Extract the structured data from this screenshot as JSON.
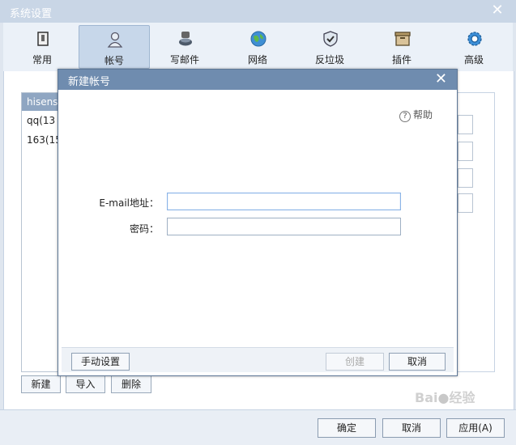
{
  "window": {
    "title": "系统设置"
  },
  "toolbar": {
    "items": [
      {
        "label": "常用",
        "icon": "general-icon"
      },
      {
        "label": "帐号",
        "icon": "account-icon"
      },
      {
        "label": "写邮件",
        "icon": "compose-icon"
      },
      {
        "label": "网络",
        "icon": "network-icon"
      },
      {
        "label": "反垃圾",
        "icon": "antispam-icon"
      },
      {
        "label": "插件",
        "icon": "plugin-icon"
      },
      {
        "label": "高级",
        "icon": "advanced-gear-icon"
      }
    ]
  },
  "accounts": {
    "header": "hisens",
    "items": [
      "qq(13",
      "163(15"
    ]
  },
  "account_buttons": {
    "new": "新建",
    "import": "导入",
    "delete": "删除"
  },
  "footer": {
    "ok": "确定",
    "cancel": "取消",
    "apply": "应用(A)"
  },
  "dialog": {
    "title": "新建帐号",
    "help": "帮助",
    "email_label": "E-mail地址：",
    "email_value": "",
    "password_label": "密码：",
    "password_value": "",
    "manual": "手动设置",
    "create": "创建",
    "cancel": "取消"
  },
  "colors": {
    "titlebar": "#c9d6e6",
    "dialog_titlebar": "#6f8caf",
    "accent": "#8fa6c2"
  }
}
